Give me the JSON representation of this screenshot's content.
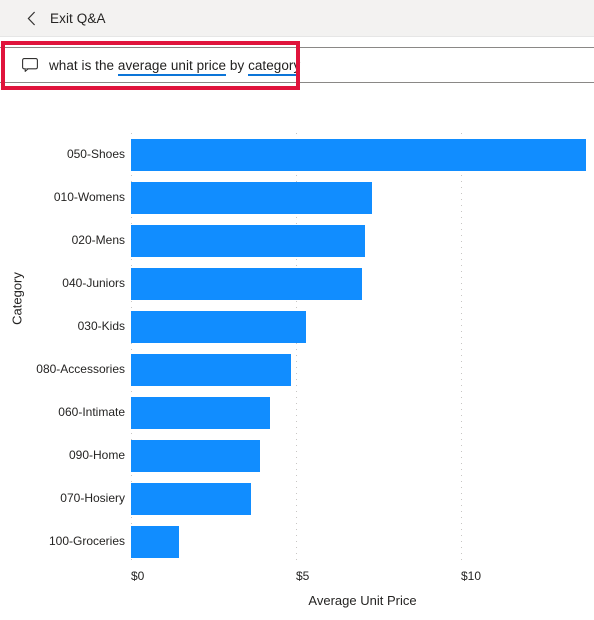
{
  "header": {
    "back_icon": "chevron-left-icon",
    "exit_label": "Exit Q&A"
  },
  "qna": {
    "icon": "speech-bubble-icon",
    "tokens": [
      {
        "text": "what is the ",
        "underlined": false
      },
      {
        "text": "average unit price",
        "underlined": true
      },
      {
        "text": " by ",
        "underlined": false
      },
      {
        "text": "category",
        "underlined": true
      }
    ],
    "full_text": "what is the average unit price by category",
    "underline_color": "#0c75d8"
  },
  "annotation": {
    "border_color": "#e0143c"
  },
  "chart_data": {
    "type": "bar",
    "orientation": "horizontal",
    "title": "",
    "xlabel": "Average Unit Price",
    "ylabel": "Category",
    "categories": [
      "050-Shoes",
      "010-Womens",
      "020-Mens",
      "040-Juniors",
      "030-Kids",
      "080-Accessories",
      "060-Intimate",
      "090-Home",
      "070-Hosiery",
      "100-Groceries"
    ],
    "values": [
      13.8,
      7.3,
      7.1,
      7.0,
      5.3,
      4.85,
      4.2,
      3.9,
      3.65,
      1.45
    ],
    "xticks": [
      0,
      5,
      10
    ],
    "xtick_labels": [
      "$0",
      "$5",
      "$10"
    ],
    "xlim": [
      0,
      14.03
    ],
    "grid": true,
    "legend": false,
    "bar_color": "#118dff"
  }
}
